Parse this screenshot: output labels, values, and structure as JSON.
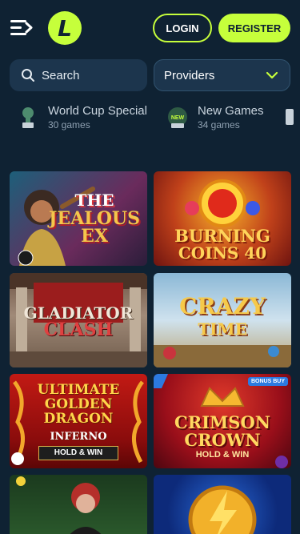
{
  "header": {
    "login_label": "LOGIN",
    "register_label": "REGISTER",
    "logo_letter": "L"
  },
  "filters": {
    "search_placeholder": "Search",
    "providers_label": "Providers"
  },
  "categories": [
    {
      "title": "World Cup Special",
      "count": "30 games",
      "icon": "trophy-icon"
    },
    {
      "title": "New Games",
      "count": "34 games",
      "icon": "new-badge-icon"
    }
  ],
  "games": [
    {
      "title_line1": "THE",
      "title_line2": "JEALOUS EX",
      "badge": ""
    },
    {
      "title_line1": "BURNING",
      "title_line2": "COINS 40",
      "badge": ""
    },
    {
      "title_line1": "GLADIATOR",
      "title_line2": "CLASH",
      "badge": ""
    },
    {
      "title_line1": "CRAZY",
      "title_line2": "TIME",
      "badge": ""
    },
    {
      "title_line1": "ULTIMATE GOLDEN DRAGON",
      "title_line2": "INFERNO",
      "subtitle": "HOLD & WIN",
      "badge": ""
    },
    {
      "title_line1": "CRIMSON",
      "title_line2": "CROWN",
      "subtitle": "HOLD & WIN",
      "badge": "BONUS BUY"
    }
  ],
  "colors": {
    "accent": "#c6ff3b",
    "background": "#0f2233",
    "surface": "#1c354d"
  }
}
